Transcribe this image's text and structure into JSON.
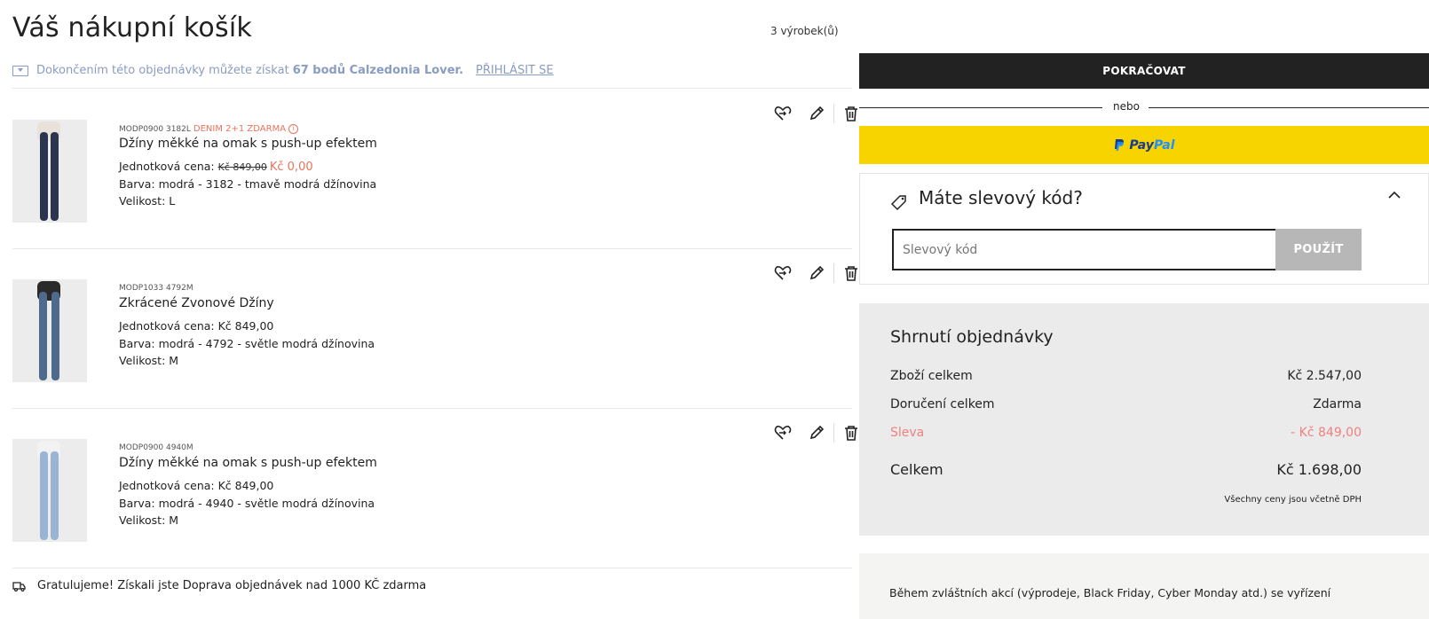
{
  "page_title": "Váš nákupní košík",
  "item_count": "3 výrobek(ů)",
  "loyalty": {
    "text_before": "Dokončením této objednávky můžete získat",
    "points": "67 bodů Calzedonia Lover.",
    "login_link": "PŘIHLÁSIT SE"
  },
  "items": [
    {
      "code": "MODP0900 3182L",
      "promo": "DENIM 2+1 ZDARMA",
      "promo_info_icon": "i",
      "name": "Džíny měkké na omak s push-up efektem",
      "unit_price_label": "Jednotková cena:",
      "old_price": "Kč 849,00",
      "price": "Kč 0,00",
      "color": "Barva: modrá - 3182 - tmavě modrá džínovina",
      "size": "Velikost: L",
      "denim_color": "#2b3550"
    },
    {
      "code": "MODP1033 4792M",
      "name": "Zkrácené Zvonové Džíny",
      "unit_price": "Jednotková cena: Kč 849,00",
      "color": "Barva: modrá - 4792 - světle modrá džínovina",
      "size": "Velikost: M",
      "denim_color": "#4f6a8c"
    },
    {
      "code": "MODP0900 4940M",
      "name": "Džíny měkké na omak s push-up efektem",
      "unit_price": "Jednotková cena: Kč 849,00",
      "color": "Barva: modrá - 4940 - světle modrá džínovina",
      "size": "Velikost: M",
      "denim_color": "#9bb4d4"
    }
  ],
  "shipping_message": "Gratulujeme! Získali jste Doprava objednávek nad 1000 KČ zdarma",
  "checkout": {
    "continue_label": "POKRAČOVAT",
    "or_label": "nebo",
    "paypal_label_pay": "Pay",
    "paypal_label_pal": "Pal"
  },
  "coupon": {
    "title": "Máte slevový kód?",
    "placeholder": "Slevový kód",
    "apply_label": "POUŽÍT"
  },
  "summary": {
    "title": "Shrnutí objednávky",
    "rows": [
      {
        "label": "Zboží celkem",
        "value": "Kč 2.547,00"
      },
      {
        "label": "Doručení celkem",
        "value": "Zdarma"
      },
      {
        "label": "Sleva",
        "value": "- Kč 849,00"
      }
    ],
    "total_label": "Celkem",
    "total_value": "Kč 1.698,00",
    "vat_note": "Všechny ceny jsou včetně DPH"
  },
  "notice_text": "Během zvláštních akcí (výprodeje, Black Friday, Cyber Monday atd.) se vyřízení",
  "colors": {
    "accent_promo": "#e9735a",
    "loyalty_blue": "#8a9cc2",
    "paypal_yellow": "#f7d400",
    "discount_pink": "#f08080",
    "dark_button": "#222222"
  },
  "icons": [
    "heart-move-icon",
    "edit-pencil-icon",
    "trash-icon",
    "tag-icon",
    "chevron-up-icon",
    "truck-icon",
    "heart-card-icon",
    "paypal-logo-icon"
  ]
}
